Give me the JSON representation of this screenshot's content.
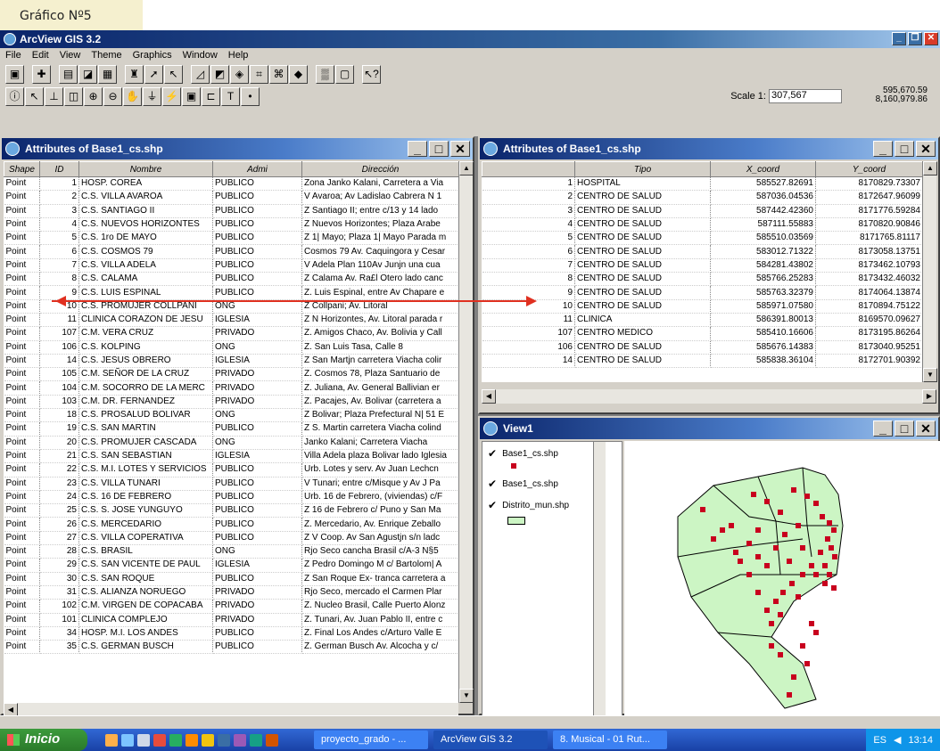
{
  "caption": "Gráfico Nº5",
  "app": {
    "title": "ArcView GIS 3.2"
  },
  "menu": [
    "File",
    "Edit",
    "View",
    "Theme",
    "Graphics",
    "Window",
    "Help"
  ],
  "scale": {
    "label": "Scale 1:",
    "value": "307,567"
  },
  "coords": {
    "x": "595,670.59",
    "y": "8,160,979.86"
  },
  "left_table": {
    "title": "Attributes of Base1_cs.shp",
    "columns": [
      "Shape",
      "ID",
      "Nombre",
      "Admi",
      "Dirección"
    ],
    "rows": [
      [
        "Point",
        "1",
        "HOSP. COREA",
        "PUBLICO",
        "Zona Janko Kalani, Carretera a Via"
      ],
      [
        "Point",
        "2",
        "C.S. VILLA AVAROA",
        "PUBLICO",
        "V Avaroa; Av Ladislao Cabrera N 1"
      ],
      [
        "Point",
        "3",
        "C.S. SANTIAGO II",
        "PUBLICO",
        "Z Santiago II; entre c/13 y 14 lado"
      ],
      [
        "Point",
        "4",
        "C.S. NUEVOS HORIZONTES",
        "PUBLICO",
        "Z Nuevos Horizontes; Plaza Arabe"
      ],
      [
        "Point",
        "5",
        "C.S. 1ro DE MAYO",
        "PUBLICO",
        "Z 1| Mayo; Plaza 1| Mayo Parada m"
      ],
      [
        "Point",
        "6",
        "C.S. COSMOS 79",
        "PUBLICO",
        "Cosmos 79 Av. Caquingora y Cesar"
      ],
      [
        "Point",
        "7",
        "C.S. VILLA ADELA",
        "PUBLICO",
        "V Adela Plan 110Av Junjn una cua"
      ],
      [
        "Point",
        "8",
        "C.S. CALAMA",
        "PUBLICO",
        "Z Calama Av. Ra£l Otero lado canc"
      ],
      [
        "Point",
        "9",
        "C.S. LUIS ESPINAL",
        "PUBLICO",
        "Z. Luis Espinal, entre Av Chapare e"
      ],
      [
        "Point",
        "10",
        "C.S. PROMUJER COLLPANI",
        "ONG",
        "Z Collpani; Av. Litoral"
      ],
      [
        "Point",
        "11",
        "CLINICA CORAZON DE JESU",
        "IGLESIA",
        "Z N Horizontes, Av. Litoral parada r"
      ],
      [
        "Point",
        "107",
        "C.M. VERA CRUZ",
        "PRIVADO",
        "Z. Amigos Chaco, Av. Bolivia y Call"
      ],
      [
        "Point",
        "106",
        "C.S. KOLPING",
        "ONG",
        "Z. San Luis Tasa, Calle 8"
      ],
      [
        "Point",
        "14",
        "C.S. JESUS OBRERO",
        "IGLESIA",
        "Z San Martjn carretera Viacha colir"
      ],
      [
        "Point",
        "105",
        "C.M. SEÑOR DE LA CRUZ",
        "PRIVADO",
        "Z. Cosmos 78, Plaza  Santuario de"
      ],
      [
        "Point",
        "104",
        "C.M. SOCORRO DE LA MERC",
        "PRIVADO",
        "Z. Juliana, Av. General Ballivian  er"
      ],
      [
        "Point",
        "103",
        "C.M. DR. FERNANDEZ",
        "PRIVADO",
        "Z. Pacajes, Av. Bolivar (carretera a"
      ],
      [
        "Point",
        "18",
        "C.S. PROSALUD BOLIVAR",
        "ONG",
        "Z Bolivar; Plaza Prefectural N| 51 E"
      ],
      [
        "Point",
        "19",
        "C.S. SAN MARTIN",
        "PUBLICO",
        "Z S. Martin carretera Viacha colind"
      ],
      [
        "Point",
        "20",
        "C.S. PROMUJER CASCADA",
        "ONG",
        "Janko Kalani; Carretera Viacha"
      ],
      [
        "Point",
        "21",
        "C.S. SAN SEBASTIAN",
        "IGLESIA",
        "Villa Adela plaza Bolivar lado Iglesia"
      ],
      [
        "Point",
        "22",
        "C.S. M.I. LOTES Y SERVICIOS",
        "PUBLICO",
        "Urb. Lotes y serv. Av Juan Lechcn"
      ],
      [
        "Point",
        "23",
        "C.S. VILLA TUNARI",
        "PUBLICO",
        "V Tunari;  entre c/Misque y Av J Pa"
      ],
      [
        "Point",
        "24",
        "C.S. 16 DE FEBRERO",
        "PUBLICO",
        "Urb. 16 de Febrero, (viviendas) c/F"
      ],
      [
        "Point",
        "25",
        "C.S. S. JOSE YUNGUYO",
        "PUBLICO",
        "Z 16 de Febrero c/ Puno y San Ma"
      ],
      [
        "Point",
        "26",
        "C.S. MERCEDARIO",
        "PUBLICO",
        "Z. Mercedario, Av. Enrique Zeballo"
      ],
      [
        "Point",
        "27",
        "C.S. VILLA COPERATIVA",
        "PUBLICO",
        "Z V Coop. Av San Agustjn s/n ladc"
      ],
      [
        "Point",
        "28",
        "C.S. BRASIL",
        "ONG",
        "Rjo Seco cancha Brasil c/A-3 N§5"
      ],
      [
        "Point",
        "29",
        "C.S. SAN VICENTE DE PAUL",
        "IGLESIA",
        "Z Pedro Domingo M c/ Bartolom| A"
      ],
      [
        "Point",
        "30",
        "C.S. SAN ROQUE",
        "PUBLICO",
        "Z San Roque Ex- tranca carretera a"
      ],
      [
        "Point",
        "31",
        "C.S. ALIANZA NORUEGO",
        "PRIVADO",
        "Rjo Seco, mercado el Carmen  Plar"
      ],
      [
        "Point",
        "102",
        "C.M. VIRGEN DE COPACABA",
        "PRIVADO",
        "Z. Nucleo Brasil, Calle Puerto Alonz"
      ],
      [
        "Point",
        "101",
        "CLINICA COMPLEJO",
        "PRIVADO",
        "Z. Tunari, Av. Juan Pablo II, entre c"
      ],
      [
        "Point",
        "34",
        "HOSP. M.I. LOS ANDES",
        "PUBLICO",
        "Z. Final Los Andes c/Arturo Valle E"
      ],
      [
        "Point",
        "35",
        "C.S. GERMAN BUSCH",
        "PUBLICO",
        "Z. German Busch Av. Alcocha y c/"
      ]
    ]
  },
  "right_table": {
    "title": "Attributes of Base1_cs.shp",
    "columns": [
      "",
      "Tipo",
      "X_coord",
      "Y_coord"
    ],
    "rows": [
      [
        "1",
        "HOSPITAL",
        "585527.82691",
        "8170829.73307"
      ],
      [
        "2",
        "CENTRO DE SALUD",
        "587036.04536",
        "8172647.96099"
      ],
      [
        "3",
        "CENTRO DE SALUD",
        "587442.42360",
        "8171776.59284"
      ],
      [
        "4",
        "CENTRO DE SALUD",
        "587111.55883",
        "8170820.90846"
      ],
      [
        "5",
        "CENTRO DE SALUD",
        "585510.03569",
        "8171765.81117"
      ],
      [
        "6",
        "CENTRO DE SALUD",
        "583012.71322",
        "8173058.13751"
      ],
      [
        "7",
        "CENTRO DE SALUD",
        "584281.43802",
        "8173462.10793"
      ],
      [
        "8",
        "CENTRO DE SALUD",
        "585766.25283",
        "8173432.46032"
      ],
      [
        "9",
        "CENTRO DE SALUD",
        "585763.32379",
        "8174064.13874"
      ],
      [
        "10",
        "CENTRO DE SALUD",
        "585971.07580",
        "8170894.75122"
      ],
      [
        "11",
        "CLINICA",
        "586391.80013",
        "8169570.09627"
      ],
      [
        "107",
        "CENTRO MEDICO",
        "585410.16606",
        "8173195.86264"
      ],
      [
        "106",
        "CENTRO DE SALUD",
        "585676.14383",
        "8173040.95251"
      ],
      [
        "14",
        "CENTRO DE SALUD",
        "585838.36104",
        "8172701.90392"
      ]
    ]
  },
  "view": {
    "title": "View1",
    "layers": [
      {
        "name": "Base1_cs.shp",
        "checked": true
      },
      {
        "name": "Base1_cs.shp",
        "checked": true
      },
      {
        "name": "Distrito_mun.shp",
        "checked": true
      }
    ],
    "colors": {
      "polygon": "#ccf5c4",
      "point": "#c8001e"
    }
  },
  "taskbar": {
    "start": "Inicio",
    "tasks": [
      "proyecto_grado - ...",
      "ArcView GIS 3.2",
      "8. Musical - 01 Rut..."
    ],
    "lang": "ES",
    "time": "13:14"
  }
}
